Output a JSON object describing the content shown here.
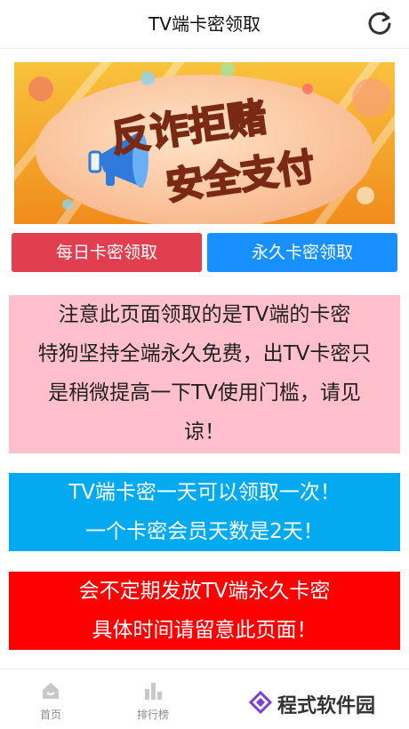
{
  "header": {
    "title": "TV端卡密领取"
  },
  "banner": {
    "line1": "反诈拒赌",
    "line2": "安全支付"
  },
  "buttons": {
    "daily": "每日卡密领取",
    "permanent": "永久卡密领取"
  },
  "notices": {
    "pink": {
      "lines": [
        "注意此页面领取的是TV端的卡密",
        "特狗坚持全端永久免费，出TV卡密只",
        "是稍微提高一下TV使用门槛，请见",
        "谅！"
      ]
    },
    "blue": {
      "lines": [
        "TV端卡密一天可以领取一次！",
        "一个卡密会员天数是2天！"
      ]
    },
    "red": {
      "lines": [
        "会不定期发放TV端永久卡密",
        "具体时间请留意此页面！"
      ]
    }
  },
  "tabbar": {
    "home": "首页",
    "ranking": "排行榜"
  },
  "watermark": {
    "text": "程式软件园"
  },
  "colors": {
    "daily_button": "#e13f4f",
    "permanent_button": "#1890ff",
    "pink_notice": "#ffc0cb",
    "blue_notice": "#03aaf0",
    "red_notice": "#ff0000",
    "banner_bg": "#f6b01e"
  }
}
